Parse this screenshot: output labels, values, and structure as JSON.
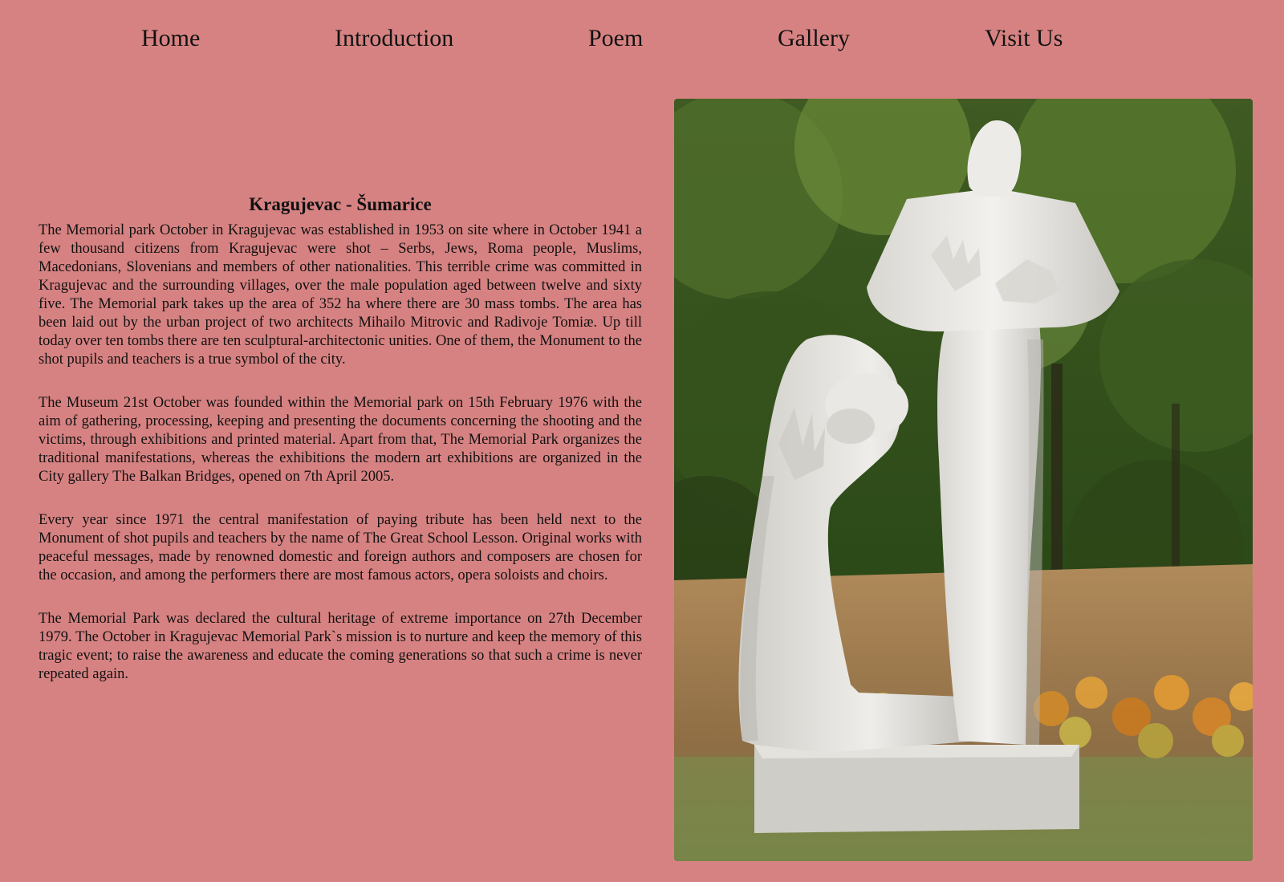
{
  "nav": {
    "items": [
      {
        "label": "Home"
      },
      {
        "label": "Introduction"
      },
      {
        "label": "Poem"
      },
      {
        "label": "Gallery"
      },
      {
        "label": "Visit Us"
      }
    ]
  },
  "main": {
    "title": "Kragujevac - Šumarice",
    "paragraphs": [
      "The Memorial park October in Kragujevac was established in 1953 on site where in October 1941 a few thousand citizens from Kragujevac were shot – Serbs, Jews, Roma people, Muslims, Macedonians, Slovenians and members of other nationalities. This terrible crime was committed in Kragujevac and the surrounding villages, over the male population aged between twelve and sixty five. The Memorial park takes up the area of 352 ha where there are 30 mass tombs. The area has been laid out by the urban project of two architects Mihailo Mitrovic and Radivoje Tomiæ. Up till today over ten tombs there are ten sculptural-architectonic unities. One of them, the Monument to the shot pupils and teachers is a true symbol of the city.",
      "The Museum 21st October was founded within the Memorial park on 15th February 1976 with the aim of gathering, processing, keeping and presenting the documents concerning the shooting and the victims, through exhibitions and printed material. Apart from that, The Memorial Park organizes the traditional manifestations, whereas the exhibitions the modern art exhibitions are organized in the City gallery The Balkan Bridges, opened on 7th April 2005.",
      "Every year since 1971 the central manifestation of paying tribute has been held next to the Monument of shot pupils and teachers by the name of The Great School Lesson. Original works with peaceful messages, made by renowned domestic and foreign authors and composers are chosen for the occasion, and among the performers there are most famous actors, opera soloists and choirs.",
      "The Memorial Park was declared the cultural heritage of extreme importance on 27th December 1979. The October in Kragujevac Memorial Park`s mission is to nurture and keep the memory of this tragic event; to raise the awareness and educate the coming generations so that such a crime is never repeated again."
    ]
  },
  "colors": {
    "page_background": "#d78282",
    "text": "#111111"
  }
}
